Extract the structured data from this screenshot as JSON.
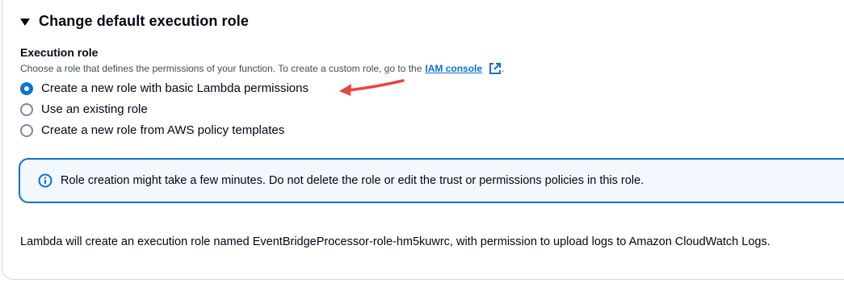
{
  "section": {
    "title": "Change default execution role"
  },
  "execution_role": {
    "label": "Execution role",
    "description": "Choose a role that defines the permissions of your function. To create a custom role, go to the",
    "link_text": "IAM console",
    "trailing_punct": ".",
    "options": [
      {
        "label": "Create a new role with basic Lambda permissions",
        "selected": true
      },
      {
        "label": "Use an existing role",
        "selected": false
      },
      {
        "label": "Create a new role from AWS policy templates",
        "selected": false
      }
    ]
  },
  "alert": {
    "icon": "info-icon",
    "text": "Role creation might take a few minutes. Do not delete the role or edit the trust or permissions policies in this role."
  },
  "footer": {
    "text": "Lambda will create an execution role named EventBridgeProcessor-role-hm5kuwrc, with permission to upload logs to Amazon CloudWatch Logs."
  },
  "colors": {
    "accent": "#0972d3",
    "alert_bg": "#f2f8fd",
    "annotation_arrow": "#e8473f"
  }
}
